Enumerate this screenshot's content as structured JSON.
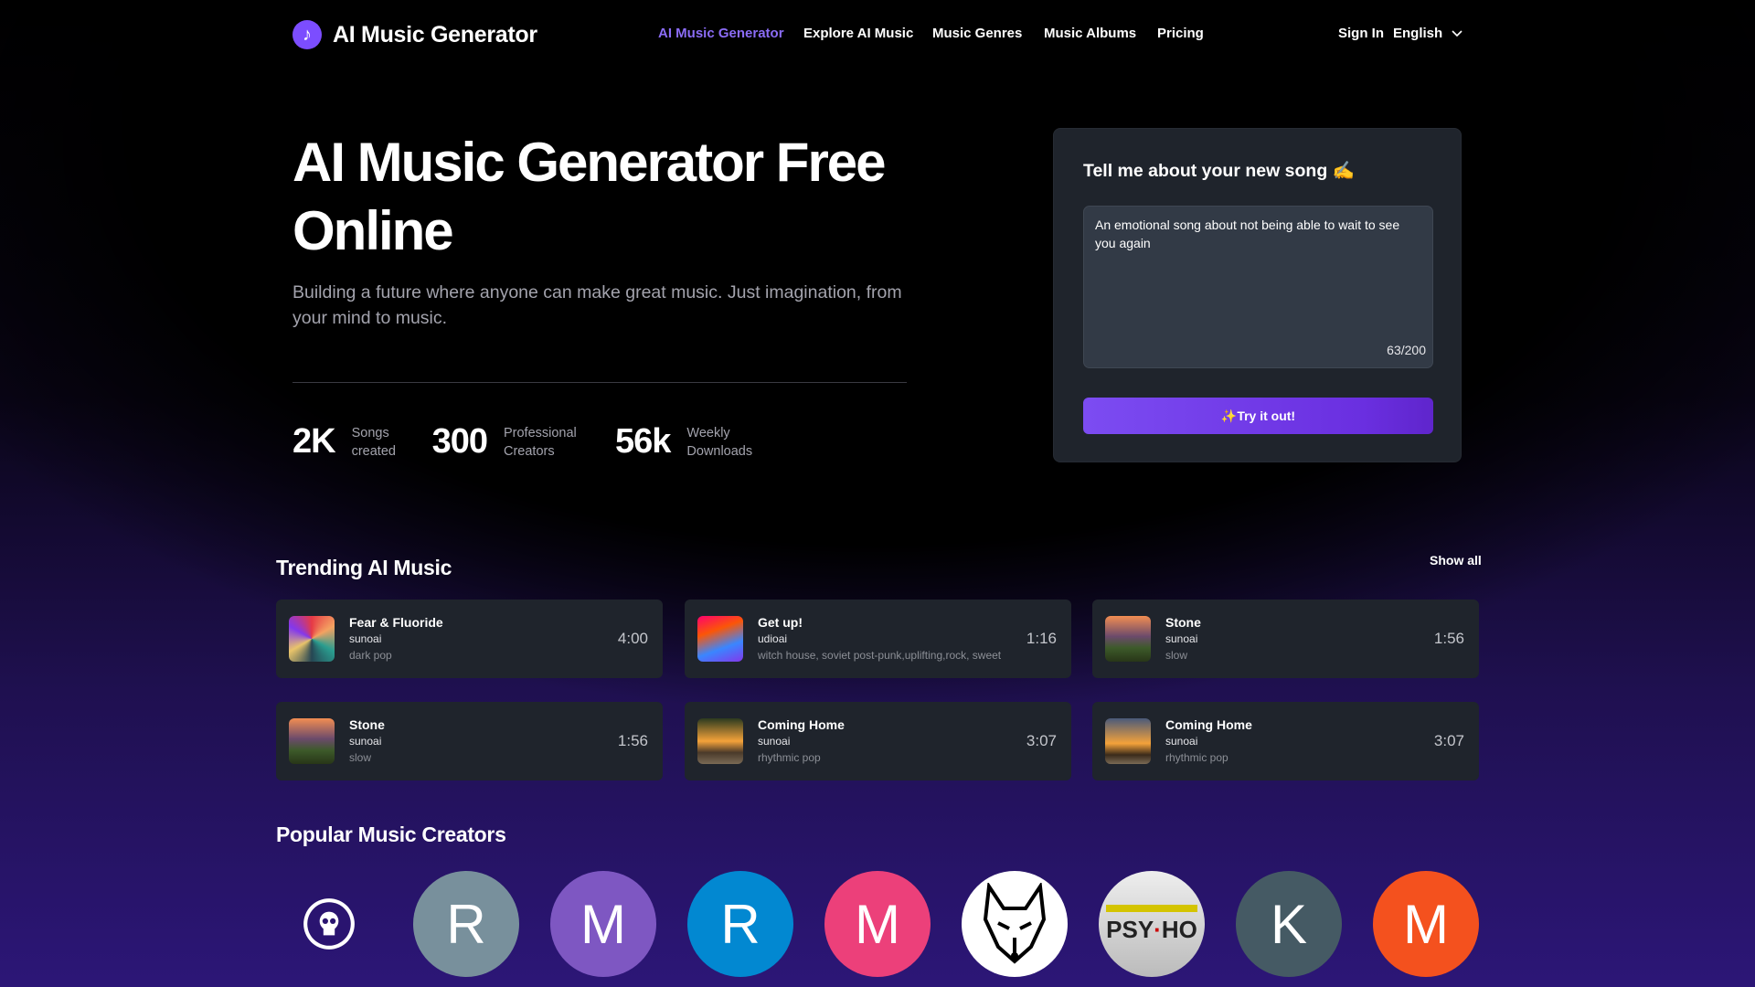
{
  "header": {
    "logo_text": "AI Music Generator",
    "logo_icon": "music-note-icon",
    "nav": [
      "AI Music Generator",
      "Explore AI Music",
      "Music Genres",
      "Music Albums",
      "Pricing"
    ],
    "active_nav": "AI Music Generator",
    "sign_in": "Sign In",
    "language": "English",
    "accent": "#8b6cf6"
  },
  "hero": {
    "title": "AI Music Generator Free Online",
    "subtitle": "Building a future where anyone can make great music. Just imagination, from your mind to music.",
    "stats": [
      {
        "value": "2K",
        "label": "Songs created"
      },
      {
        "value": "300",
        "label": "Professional Creators"
      },
      {
        "value": "56k",
        "label": "Weekly Downloads"
      }
    ]
  },
  "prompt_card": {
    "heading": "Tell me about your new song ✍️",
    "value": "An emotional song about not being able to wait to see you again",
    "counter": "63/200",
    "button": "✨Try it out!"
  },
  "trending": {
    "heading": "Trending AI Music",
    "show_all": "Show all",
    "songs": [
      {
        "title": "Fear & Fluoride",
        "artist": "sunoai",
        "tags": "dark pop",
        "duration": "4:00"
      },
      {
        "title": "Get up!",
        "artist": "udioai",
        "tags": "witch house, soviet post-punk,uplifting,rock, sweet",
        "duration": "1:16"
      },
      {
        "title": "Stone",
        "artist": "sunoai",
        "tags": "slow",
        "duration": "1:56"
      },
      {
        "title": "Stone",
        "artist": "sunoai",
        "tags": "slow",
        "duration": "1:56"
      },
      {
        "title": "Coming Home",
        "artist": "sunoai",
        "tags": "rhythmic pop",
        "duration": "3:07"
      },
      {
        "title": "Coming Home",
        "artist": "sunoai",
        "tags": "rhythmic pop",
        "duration": "3:07"
      }
    ]
  },
  "creators": {
    "heading": "Popular Music Creators",
    "avatars": [
      {
        "letter": "",
        "color": "transparent",
        "icon": "skull-logo-icon"
      },
      {
        "letter": "R",
        "color": "#78909c"
      },
      {
        "letter": "M",
        "color": "#7e57c2"
      },
      {
        "letter": "R",
        "color": "#0288d1"
      },
      {
        "letter": "M",
        "color": "#ec407a"
      },
      {
        "letter": "",
        "color": "#ffffff",
        "icon": "wolf-icon"
      },
      {
        "letter": "",
        "color": "#f2f2f2",
        "icon": "psycho-image-icon",
        "logo_text": "PSYCHO"
      },
      {
        "letter": "K",
        "color": "#455a64"
      },
      {
        "letter": "M",
        "color": "#f4511e"
      }
    ]
  }
}
